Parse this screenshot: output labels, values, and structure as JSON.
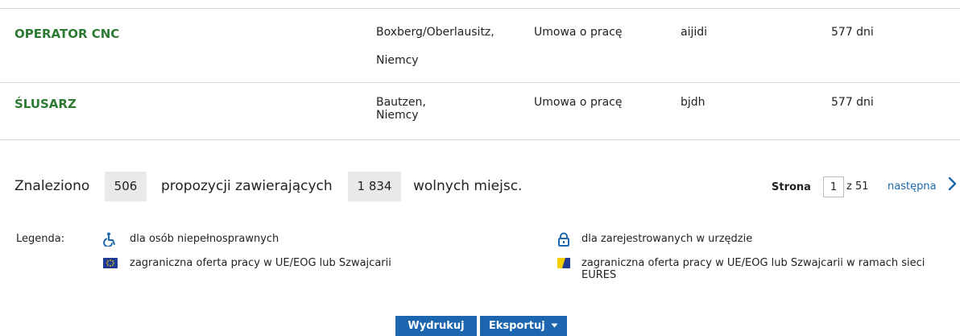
{
  "results": [
    {
      "title": "OPERATOR CNC",
      "location_line1": "Boxberg/Oberlausitz,",
      "location_line2": "Niemcy",
      "contract": "Umowa o pracę",
      "employer": "aijidi",
      "days": "577 dni"
    },
    {
      "title": "ŚLUSARZ",
      "location_line1": "Bautzen,",
      "location_line2": "Niemcy",
      "contract": "Umowa o pracę",
      "employer": "bjdh",
      "days": "577 dni"
    }
  ],
  "summary": {
    "found_label": "Znaleziono",
    "offers_count": "506",
    "offers_label": "propozycji zawierających",
    "vacancies_count": "1 834",
    "vacancies_label": "wolnych miejsc."
  },
  "pagination": {
    "page_label": "Strona",
    "current_page": "1",
    "of_label": "z 51",
    "next_label": "następna"
  },
  "legend": {
    "label": "Legenda:",
    "items": [
      {
        "icon": "wheelchair-icon",
        "text": "dla osób niepełnosprawnych"
      },
      {
        "icon": "lock-icon",
        "text": "dla zarejestrowanych w urzędzie"
      },
      {
        "icon": "eu-flag-icon",
        "text": "zagraniczna oferta pracy w UE/EOG lub Szwajcarii"
      },
      {
        "icon": "eures-icon",
        "text": "zagraniczna oferta pracy w UE/EOG lub Szwajcarii w ramach sieci EURES"
      }
    ]
  },
  "actions": {
    "print_label": "Wydrukuj",
    "export_label": "Eksportuj"
  },
  "colors": {
    "title_green": "#2d7a32",
    "link_blue": "#1a67ad",
    "button_blue": "#1c66b0",
    "wheelchair_blue": "#1a67ad",
    "eu_blue": "#1f3b94",
    "eures_yellow": "#f3cf00"
  }
}
